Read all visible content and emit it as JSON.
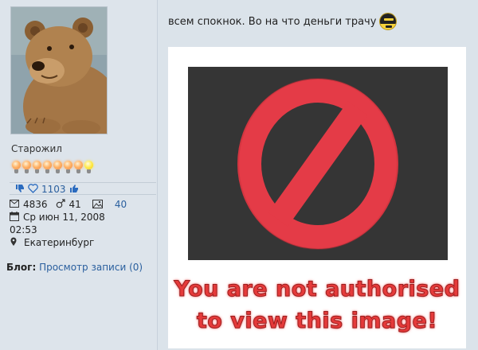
{
  "user": {
    "rank": "Старожил",
    "reputation": {
      "likes": "1103"
    },
    "stats": {
      "messages": "4836",
      "gender_count": "41",
      "images": "40",
      "registered_date": "Ср июн 11, 2008",
      "registered_time": "02:53",
      "location": "Екатеринбург"
    },
    "blog": {
      "label": "Блог:",
      "link": "Просмотр записи (0)"
    }
  },
  "post": {
    "text": "всем спокнок. Во на что деньги трачу",
    "image_notice": {
      "line1": "You are not authorised",
      "line2": "to view this image!"
    }
  },
  "colors": {
    "link": "#2a5f9e",
    "notice_red": "#e53a3a",
    "forbid_red": "#e43b47"
  },
  "icons": [
    "thumb-down-icon",
    "heart-icon",
    "thumb-up-icon",
    "envelope-icon",
    "male-icon",
    "image-icon",
    "calendar-icon",
    "location-pin-icon",
    "masked-smiley-icon",
    "forbidden-icon",
    "bulb-icon"
  ]
}
